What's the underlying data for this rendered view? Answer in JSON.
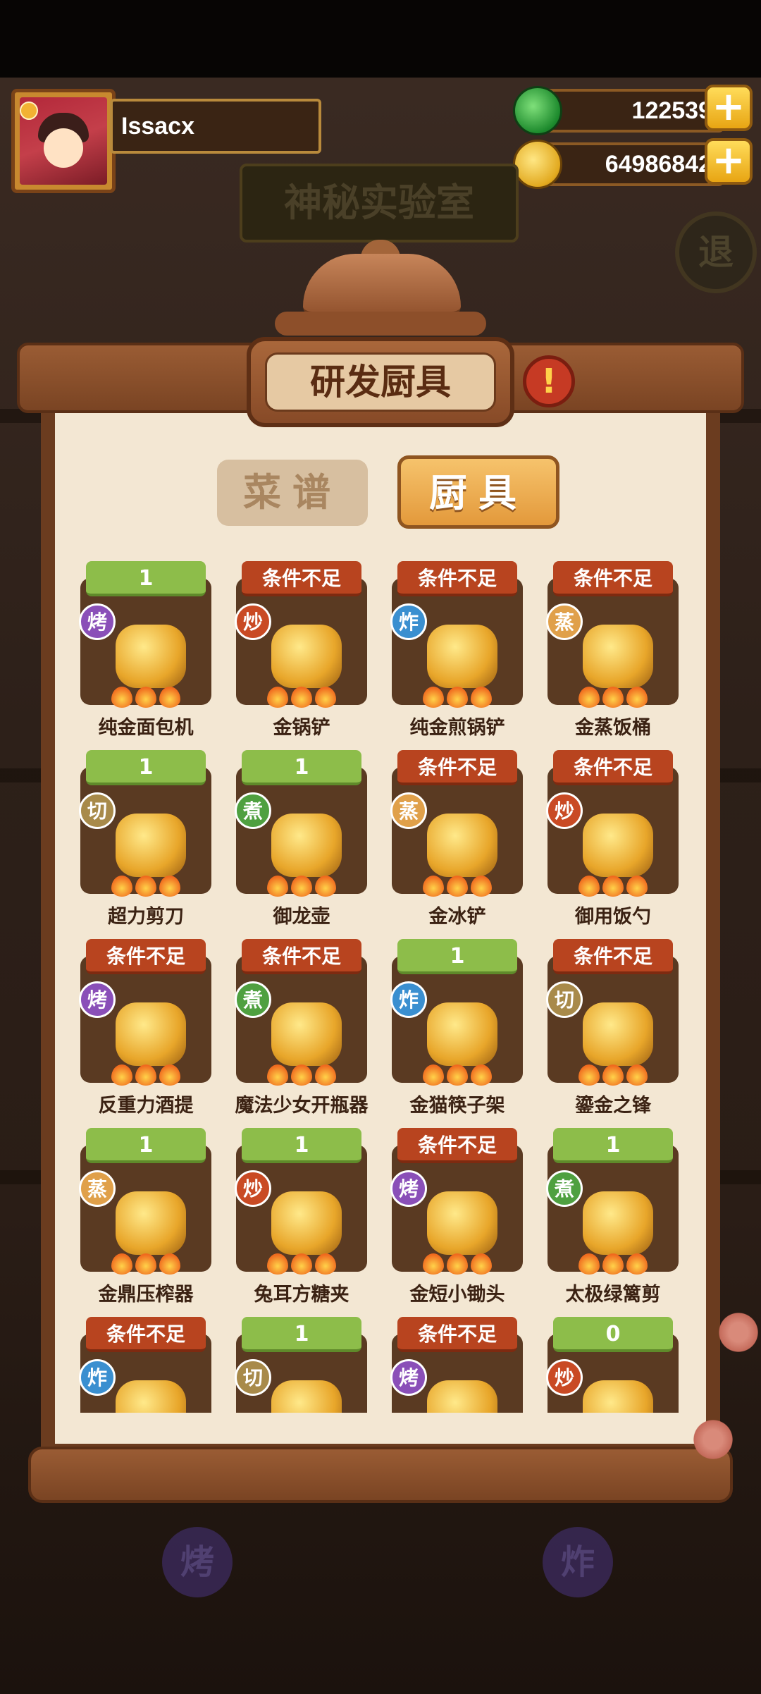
{
  "player": {
    "name": "Issacx"
  },
  "currencies": {
    "jade": {
      "value": "122539",
      "icon": "jade-icon"
    },
    "gold": {
      "value": "64986842",
      "icon": "coin-icon"
    }
  },
  "background": {
    "lab_title": "神秘实验室",
    "exit_label": "退",
    "bottom_badges": [
      "烤",
      "炸"
    ]
  },
  "panel": {
    "title": "研发厨具",
    "alert": "!",
    "tabs": [
      {
        "label": "菜谱",
        "active": false
      },
      {
        "label": "厨具",
        "active": true
      }
    ]
  },
  "tools": [
    {
      "status": "1",
      "ok": true,
      "method": "烤",
      "name": "纯金面包机"
    },
    {
      "status": "条件不足",
      "ok": false,
      "method": "炒",
      "name": "金锅铲"
    },
    {
      "status": "条件不足",
      "ok": false,
      "method": "炸",
      "name": "纯金煎锅铲"
    },
    {
      "status": "条件不足",
      "ok": false,
      "method": "蒸",
      "name": "金蒸饭桶"
    },
    {
      "status": "1",
      "ok": true,
      "method": "切",
      "name": "超力剪刀"
    },
    {
      "status": "1",
      "ok": true,
      "method": "煮",
      "name": "御龙壶"
    },
    {
      "status": "条件不足",
      "ok": false,
      "method": "蒸",
      "name": "金冰铲"
    },
    {
      "status": "条件不足",
      "ok": false,
      "method": "炒",
      "name": "御用饭勺"
    },
    {
      "status": "条件不足",
      "ok": false,
      "method": "烤",
      "name": "反重力酒提"
    },
    {
      "status": "条件不足",
      "ok": false,
      "method": "煮",
      "name": "魔法少女开瓶器"
    },
    {
      "status": "1",
      "ok": true,
      "method": "炸",
      "name": "金猫筷子架"
    },
    {
      "status": "条件不足",
      "ok": false,
      "method": "切",
      "name": "鎏金之锋"
    },
    {
      "status": "1",
      "ok": true,
      "method": "蒸",
      "name": "金鼎压榨器"
    },
    {
      "status": "1",
      "ok": true,
      "method": "炒",
      "name": "兔耳方糖夹"
    },
    {
      "status": "条件不足",
      "ok": false,
      "method": "烤",
      "name": "金短小锄头"
    },
    {
      "status": "1",
      "ok": true,
      "method": "煮",
      "name": "太极绿篱剪"
    },
    {
      "status": "条件不足",
      "ok": false,
      "method": "炸",
      "name": ""
    },
    {
      "status": "1",
      "ok": true,
      "method": "切",
      "name": ""
    },
    {
      "status": "条件不足",
      "ok": false,
      "method": "烤",
      "name": ""
    },
    {
      "status": "0",
      "ok": true,
      "method": "炒",
      "name": ""
    }
  ],
  "method_colors": {
    "烤": "#8a4fb8",
    "炒": "#c94a24",
    "炸": "#3a8fd0",
    "蒸": "#e0a04a",
    "切": "#a88a4a",
    "煮": "#4fa040"
  }
}
